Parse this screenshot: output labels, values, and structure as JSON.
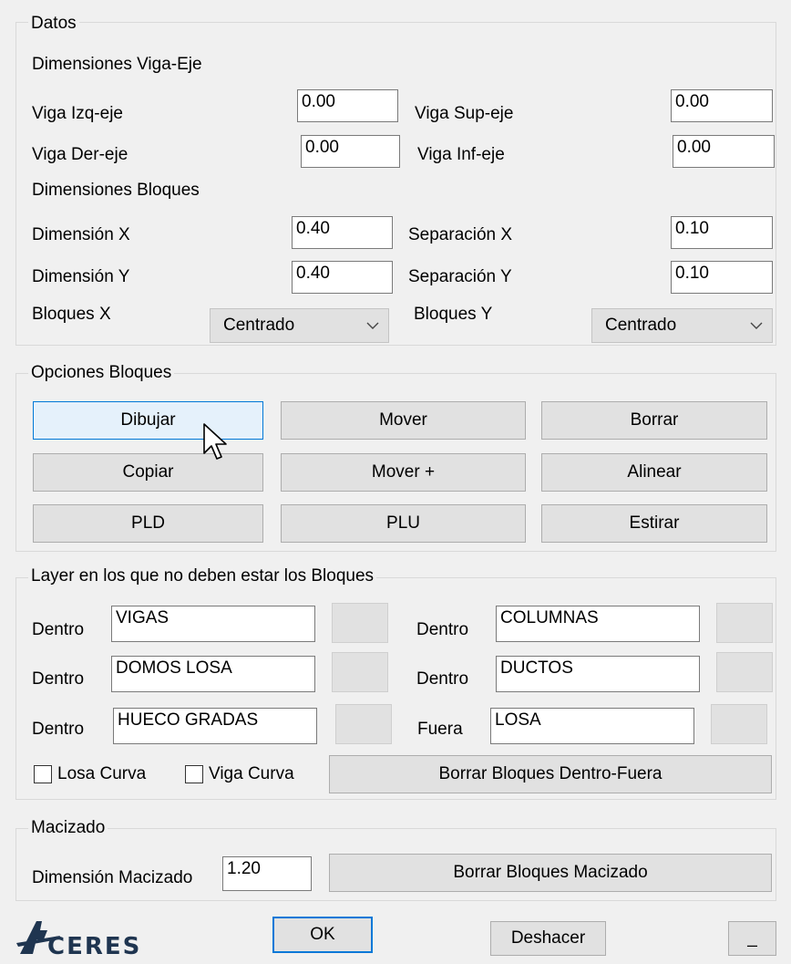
{
  "datos": {
    "title": "Datos",
    "viga_eje_heading": "Dimensiones Viga-Eje",
    "viga_izq_label": "Viga Izq-eje",
    "viga_izq_value": "0.00",
    "viga_sup_label": "Viga Sup-eje",
    "viga_sup_value": "0.00",
    "viga_der_label": "Viga Der-eje",
    "viga_der_value": "0.00",
    "viga_inf_label": "Viga Inf-eje",
    "viga_inf_value": "0.00",
    "bloques_heading": "Dimensiones Bloques",
    "dim_x_label": "Dimensión X",
    "dim_x_value": "0.40",
    "sep_x_label": "Separación X",
    "sep_x_value": "0.10",
    "dim_y_label": "Dimensión Y",
    "dim_y_value": "0.40",
    "sep_y_label": "Separación Y",
    "sep_y_value": "0.10",
    "bloques_x_label": "Bloques X",
    "bloques_x_value": "Centrado",
    "bloques_y_label": "Bloques Y",
    "bloques_y_value": "Centrado"
  },
  "opciones": {
    "title": "Opciones Bloques",
    "dibujar": "Dibujar",
    "mover": "Mover",
    "borrar": "Borrar",
    "copiar": "Copiar",
    "mover_plus": "Mover +",
    "alinear": "Alinear",
    "pld": "PLD",
    "plu": "PLU",
    "estirar": "Estirar"
  },
  "layers": {
    "title": "Layer en los que no deben estar los Bloques",
    "rows": [
      {
        "left_label": "Dentro",
        "left_value": "VIGAS",
        "right_label": "Dentro",
        "right_value": "COLUMNAS"
      },
      {
        "left_label": "Dentro",
        "left_value": "DOMOS LOSA",
        "right_label": "Dentro",
        "right_value": "DUCTOS"
      },
      {
        "left_label": "Dentro",
        "left_value": "HUECO GRADAS",
        "right_label": "Fuera",
        "right_value": "LOSA"
      }
    ],
    "losa_curva_label": "Losa Curva",
    "viga_curva_label": "Viga Curva",
    "borrar_dentro_fuera": "Borrar Bloques Dentro-Fuera"
  },
  "macizado": {
    "title": "Macizado",
    "dim_label": "Dimensión Macizado",
    "dim_value": "1.20",
    "borrar_macizado": "Borrar Bloques Macizado"
  },
  "footer": {
    "logo_text": "CERES",
    "ok": "OK",
    "deshacer": "Deshacer",
    "minimize": "_"
  },
  "colors": {
    "accent": "#0078d7",
    "hover_fill": "#e5f1fb",
    "logo": "#1f3550"
  },
  "icons": [
    "arrow-cursor-icon",
    "chevron-down-icon",
    "aceres-logo-icon"
  ]
}
